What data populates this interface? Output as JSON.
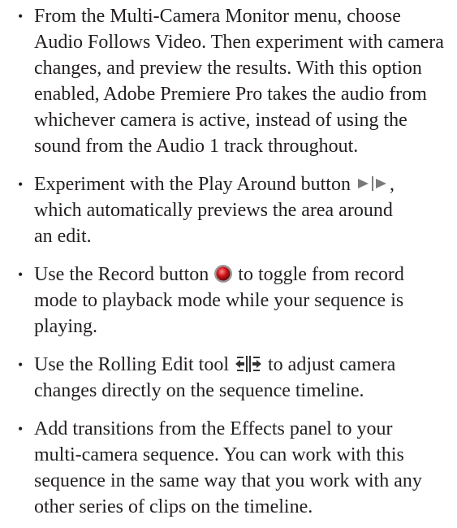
{
  "bullets": [
    {
      "lines": [
        "From the Multi-Camera Monitor menu, choose",
        "Audio Follows Video. Then experiment with camera",
        "changes, and preview the results. With this option",
        "enabled, Adobe Premiere Pro takes the audio from",
        "whichever camera is active, instead of using the",
        "sound from the Audio 1 track throughout."
      ]
    },
    {
      "line1_before": "Experiment with the Play Around button",
      "line1_after": ",",
      "icon": "play-around-icon",
      "lines_rest": [
        "which automatically previews the area around",
        "an edit."
      ]
    },
    {
      "line1_before": "Use the Record button",
      "line1_after": "to toggle from record",
      "icon": "record-icon",
      "lines_rest": [
        "mode to playback mode while your sequence is",
        "playing."
      ]
    },
    {
      "line1_before": "Use the Rolling Edit tool",
      "line1_after": "to adjust camera",
      "icon": "rolling-edit-icon",
      "lines_rest": [
        "changes directly on the sequence timeline."
      ]
    },
    {
      "lines": [
        "Add transitions from the Effects panel to your",
        "multi-camera sequence. You can work with this",
        "sequence in the same way that you work with any",
        "other series of clips on the timeline."
      ]
    }
  ],
  "bullet_symbol": "•",
  "colors": {
    "text": "#231f20",
    "record_red": "#d0141b"
  }
}
